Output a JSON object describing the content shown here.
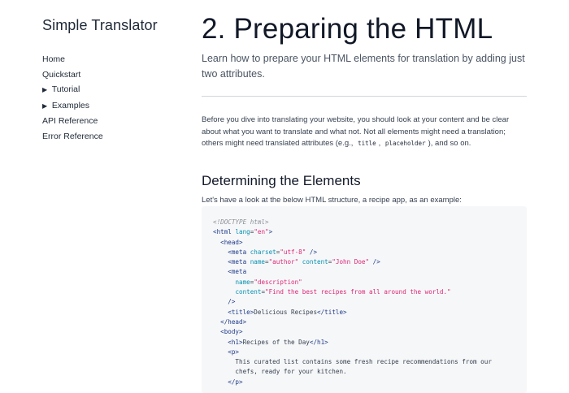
{
  "sidebar": {
    "site_title": "Simple Translator",
    "items": [
      {
        "label": "Home",
        "expandable": false
      },
      {
        "label": "Quickstart",
        "expandable": false
      },
      {
        "label": "Tutorial",
        "expandable": true
      },
      {
        "label": "Examples",
        "expandable": true
      },
      {
        "label": "API Reference",
        "expandable": false
      },
      {
        "label": "Error Reference",
        "expandable": false
      }
    ],
    "expand_icon": "triangle-right-icon"
  },
  "main": {
    "title": "2. Preparing the HTML",
    "lead": "Learn how to prepare your HTML elements for translation by adding just two attributes.",
    "intro": {
      "before": "Before you dive into translating your website, you should look at your content and be clear about what you want to translate and what not. Not all elements might need a translation; others might need translated attributes (e.g.,",
      "code1": "title",
      "sep": ",",
      "code2": "placeholder",
      "after": "), and so on."
    },
    "section_title": "Determining the Elements",
    "section_text": "Let's have a look at the below HTML structure, a recipe app, as an example:"
  },
  "code": {
    "lines": [
      [
        {
          "t": "<!DOCTYPE html>",
          "c": "comment"
        }
      ],
      [
        {
          "t": "<html ",
          "c": "tag"
        },
        {
          "t": "lang",
          "c": "attr"
        },
        {
          "t": "=",
          "c": "plain"
        },
        {
          "t": "\"en\"",
          "c": "val"
        },
        {
          "t": ">",
          "c": "tag"
        }
      ],
      [
        {
          "t": "  <head>",
          "c": "tag"
        }
      ],
      [
        {
          "t": "    <meta ",
          "c": "tag"
        },
        {
          "t": "charset",
          "c": "attr"
        },
        {
          "t": "=",
          "c": "plain"
        },
        {
          "t": "\"utf-8\"",
          "c": "val"
        },
        {
          "t": " />",
          "c": "tag"
        }
      ],
      [
        {
          "t": "    <meta ",
          "c": "tag"
        },
        {
          "t": "name",
          "c": "attr"
        },
        {
          "t": "=",
          "c": "plain"
        },
        {
          "t": "\"author\"",
          "c": "val"
        },
        {
          "t": " ",
          "c": "plain"
        },
        {
          "t": "content",
          "c": "attr"
        },
        {
          "t": "=",
          "c": "plain"
        },
        {
          "t": "\"John Doe\"",
          "c": "val"
        },
        {
          "t": " />",
          "c": "tag"
        }
      ],
      [
        {
          "t": "    <meta",
          "c": "tag"
        }
      ],
      [
        {
          "t": "      ",
          "c": "plain"
        },
        {
          "t": "name",
          "c": "attr"
        },
        {
          "t": "=",
          "c": "plain"
        },
        {
          "t": "\"description\"",
          "c": "val"
        }
      ],
      [
        {
          "t": "      ",
          "c": "plain"
        },
        {
          "t": "content",
          "c": "attr"
        },
        {
          "t": "=",
          "c": "plain"
        },
        {
          "t": "\"Find the best recipes from all around the world.\"",
          "c": "val"
        }
      ],
      [
        {
          "t": "    />",
          "c": "tag"
        }
      ],
      [
        {
          "t": "    <title>",
          "c": "tag"
        },
        {
          "t": "Delicious Recipes",
          "c": "plain"
        },
        {
          "t": "</title>",
          "c": "tag"
        }
      ],
      [
        {
          "t": "  </head>",
          "c": "tag"
        }
      ],
      [
        {
          "t": "  <body>",
          "c": "tag"
        }
      ],
      [
        {
          "t": "    <h1>",
          "c": "tag"
        },
        {
          "t": "Recipes of the Day",
          "c": "plain"
        },
        {
          "t": "</h1>",
          "c": "tag"
        }
      ],
      [
        {
          "t": "    <p>",
          "c": "tag"
        }
      ],
      [
        {
          "t": "      This curated list contains some fresh recipe recommendations from our",
          "c": "plain"
        }
      ],
      [
        {
          "t": "      chefs, ready for your kitchen.",
          "c": "plain"
        }
      ],
      [
        {
          "t": "    </p>",
          "c": "tag"
        }
      ]
    ]
  },
  "colors": {
    "background": "#ffffff",
    "code_background": "#f6f7f8",
    "tag": "#1e3a8a",
    "attribute": "#0891b2",
    "value": "#db2777",
    "comment": "#8a8f98",
    "divider": "#d1d5db"
  }
}
